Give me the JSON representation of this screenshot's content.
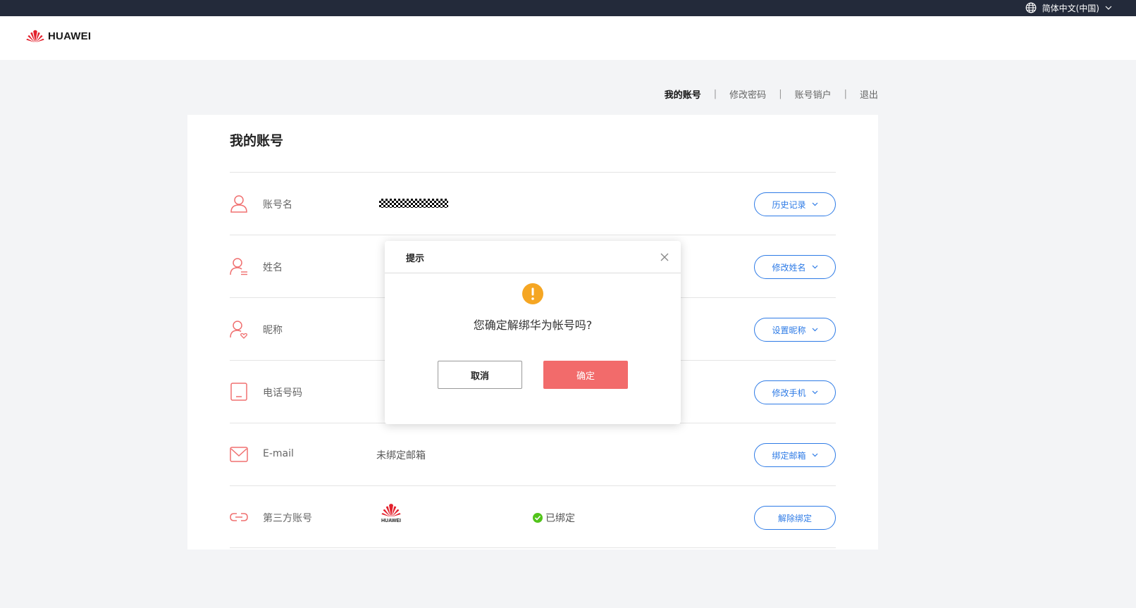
{
  "topbar": {
    "language": "简体中文(中国)"
  },
  "header": {
    "logo_text": "HUAWEI"
  },
  "subnav": {
    "items": [
      "我的账号",
      "修改密码",
      "账号销户",
      "退出"
    ],
    "separator": "|"
  },
  "card": {
    "title": "我的账号",
    "rows": [
      {
        "label": "账号名",
        "value": "",
        "button": "历史记录",
        "icon": "user-icon"
      },
      {
        "label": "姓名",
        "value": "",
        "button": "修改姓名",
        "icon": "user-list-icon"
      },
      {
        "label": "昵称",
        "value": "",
        "button": "设置昵称",
        "icon": "user-heart-icon"
      },
      {
        "label": "电话号码",
        "value": "",
        "button": "修改手机",
        "icon": "phone-icon"
      },
      {
        "label": "E-mail",
        "value": "未绑定邮箱",
        "button": "绑定邮箱",
        "icon": "mail-icon"
      },
      {
        "label": "第三方账号",
        "value": "",
        "status": "已绑定",
        "button": "解除绑定",
        "icon": "link-icon",
        "logo_text": "HUAWEI"
      }
    ]
  },
  "dialog": {
    "title": "提示",
    "message": "您确定解绑华为帐号吗?",
    "cancel_label": "取消",
    "confirm_label": "确定"
  },
  "colors": {
    "accent_blue": "#2e7be6",
    "confirm_red": "#f26b6b",
    "icon_red": "#f07070",
    "warning_orange": "#f5a623",
    "success_green": "#52c41a",
    "topbar_dark": "#232a3a"
  }
}
